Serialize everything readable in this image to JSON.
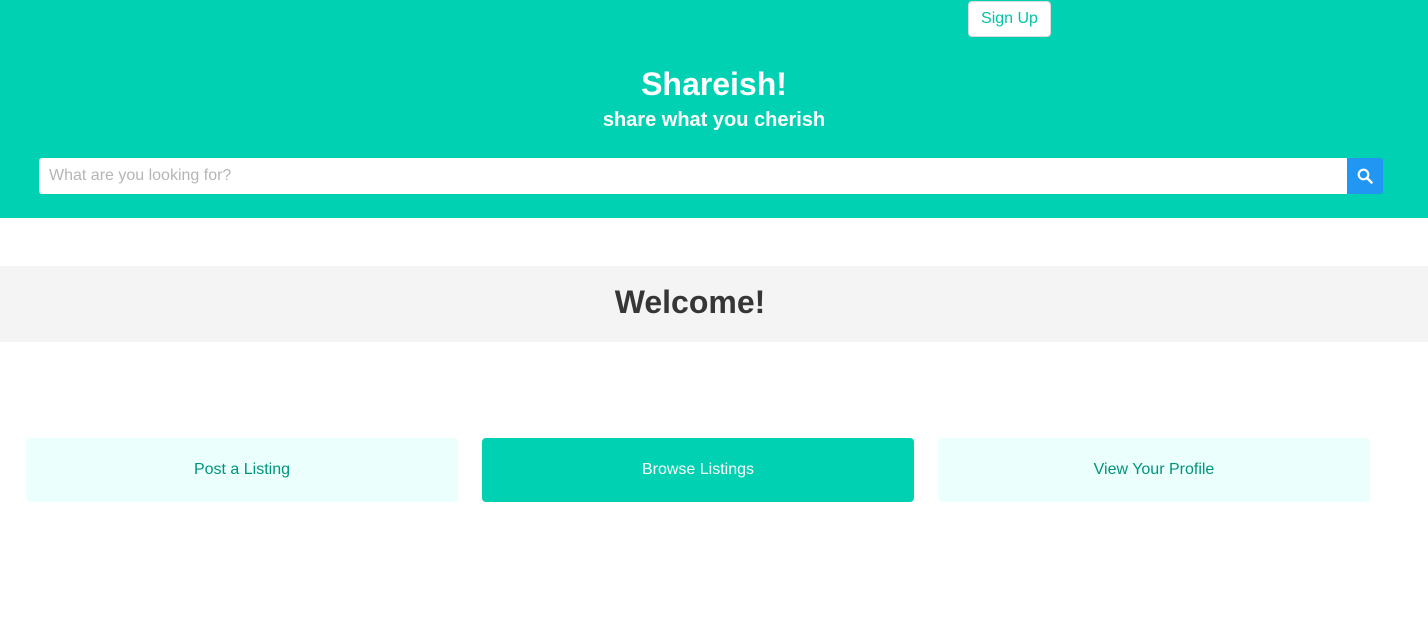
{
  "header": {
    "signup_label": "Sign Up",
    "title": "Shareish!",
    "subtitle": "share what you cherish",
    "search_placeholder": "What are you looking for?",
    "search_icon": "search-icon"
  },
  "main": {
    "welcome": "Welcome!",
    "actions": [
      {
        "label": "Post a Listing"
      },
      {
        "label": "Browse Listings"
      },
      {
        "label": "View Your Profile"
      }
    ]
  },
  "colors": {
    "primary": "#00d1b2",
    "light_primary": "#ebfffc",
    "dark_primary_text": "#00947e",
    "search_button": "#2196f3",
    "band": "#f4f4f4",
    "heading_text": "#363636"
  }
}
